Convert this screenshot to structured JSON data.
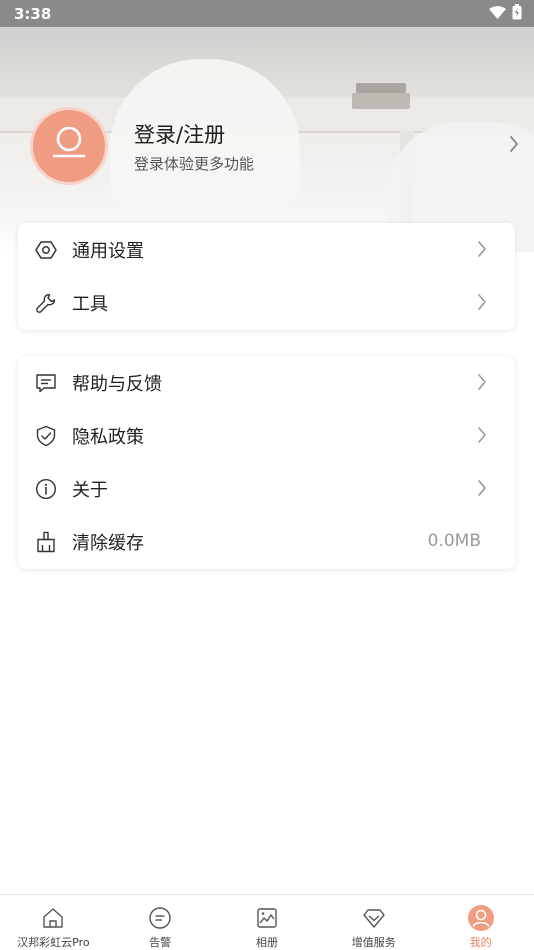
{
  "status_bar": {
    "time": "3:38"
  },
  "profile": {
    "title": "登录/注册",
    "subtitle": "登录体验更多功能"
  },
  "group1": [
    {
      "label": "通用设置",
      "icon": "settings-hex-icon"
    },
    {
      "label": "工具",
      "icon": "wrench-icon"
    }
  ],
  "group2": [
    {
      "label": "帮助与反馈",
      "icon": "feedback-icon"
    },
    {
      "label": "隐私政策",
      "icon": "shield-check-icon"
    },
    {
      "label": "关于",
      "icon": "info-icon"
    },
    {
      "label": "清除缓存",
      "icon": "broom-icon",
      "value": "0.0MB"
    }
  ],
  "tabs": [
    {
      "label": "汉邦彩虹云Pro",
      "icon": "home-icon"
    },
    {
      "label": "告警",
      "icon": "alert-icon"
    },
    {
      "label": "相册",
      "icon": "album-icon"
    },
    {
      "label": "增值服务",
      "icon": "diamond-icon"
    },
    {
      "label": "我的",
      "icon": "user-icon",
      "active": true
    }
  ],
  "colors": {
    "accent": "#e8825f",
    "avatar": "#f09c83"
  }
}
